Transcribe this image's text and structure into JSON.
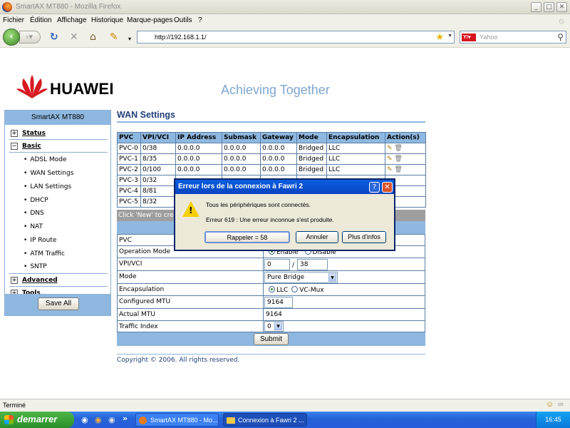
{
  "window": {
    "title": "SmartAX MT880 - Mozilla Firefox"
  },
  "menu": [
    "Fichier",
    "Édition",
    "Affichage",
    "Historique",
    "Marque-pages",
    "Outils",
    "?"
  ],
  "url": "http://192.168.1.1/",
  "search_placeholder": "Yahoo",
  "brand": {
    "name": "HUAWEI",
    "slogan": "Achieving Together"
  },
  "sidebar": {
    "title": "SmartAX MT880",
    "sections": [
      {
        "label": "Status",
        "expanded": false
      },
      {
        "label": "Basic",
        "expanded": true,
        "items": [
          "ADSL Mode",
          "WAN Settings",
          "LAN Settings",
          "DHCP",
          "DNS",
          "NAT",
          "IP Route",
          "ATM Traffic",
          "SNTP"
        ]
      },
      {
        "label": "Advanced",
        "expanded": false
      },
      {
        "label": "Tools",
        "expanded": false
      }
    ],
    "save_all": "Save All"
  },
  "page_title": "WAN Settings",
  "pvc_table": {
    "headers": [
      "PVC",
      "VPI/VCI",
      "IP Address",
      "Submask",
      "Gateway",
      "Mode",
      "Encapsulation",
      "Action(s)"
    ],
    "rows": [
      [
        "PVC-0",
        "0/38",
        "0.0.0.0",
        "0.0.0.0",
        "0.0.0.0",
        "Bridged",
        "LLC"
      ],
      [
        "PVC-1",
        "8/35",
        "0.0.0.0",
        "0.0.0.0",
        "0.0.0.0",
        "Bridged",
        "LLC"
      ],
      [
        "PVC-2",
        "0/100",
        "0.0.0.0",
        "0.0.0.0",
        "0.0.0.0",
        "Bridged",
        "LLC"
      ],
      [
        "PVC-3",
        "0/32",
        "",
        "",
        "",
        "",
        ""
      ],
      [
        "PVC-4",
        "8/81",
        "",
        "",
        "",
        "",
        ""
      ],
      [
        "PVC-5",
        "8/32",
        "",
        "",
        "",
        "",
        ""
      ]
    ],
    "hint": "Click 'New' to cre"
  },
  "form": {
    "pvc_label": "PVC",
    "operation_mode_label": "Operation Mode",
    "enable": "Enable",
    "disable": "Disable",
    "vpivci_label": "VPI/VCI",
    "vpi": "0",
    "vci": "38",
    "slash": "/",
    "mode_label": "Mode",
    "mode_value": "Pure Bridge",
    "encap_label": "Encapsulation",
    "llc": "LLC",
    "vcmux": "VC-Mux",
    "cmtu_label": "Configured MTU",
    "cmtu_value": "9164",
    "amtu_label": "Actual MTU",
    "amtu_value": "9164",
    "traffic_label": "Traffic Index",
    "traffic_value": "0",
    "submit": "Submit"
  },
  "copyright": "Copyright © 2006. All rights reserved.",
  "dialog": {
    "title": "Erreur lors de la connexion à Fawri 2",
    "line1": "Tous les périphériques sont connectés.",
    "line2": "Erreur 619 : Une erreur inconnue s'est produite.",
    "btn_redial": "Rappeler = 58",
    "btn_cancel": "Annuler",
    "btn_more": "Plus d'infos"
  },
  "status_text": "Terminé",
  "taskbar": {
    "start": "demarrer",
    "task1": "SmartAX MT880 - Mo...",
    "task2": "Connexion à Fawri 2 ...",
    "clock": "16:45"
  }
}
